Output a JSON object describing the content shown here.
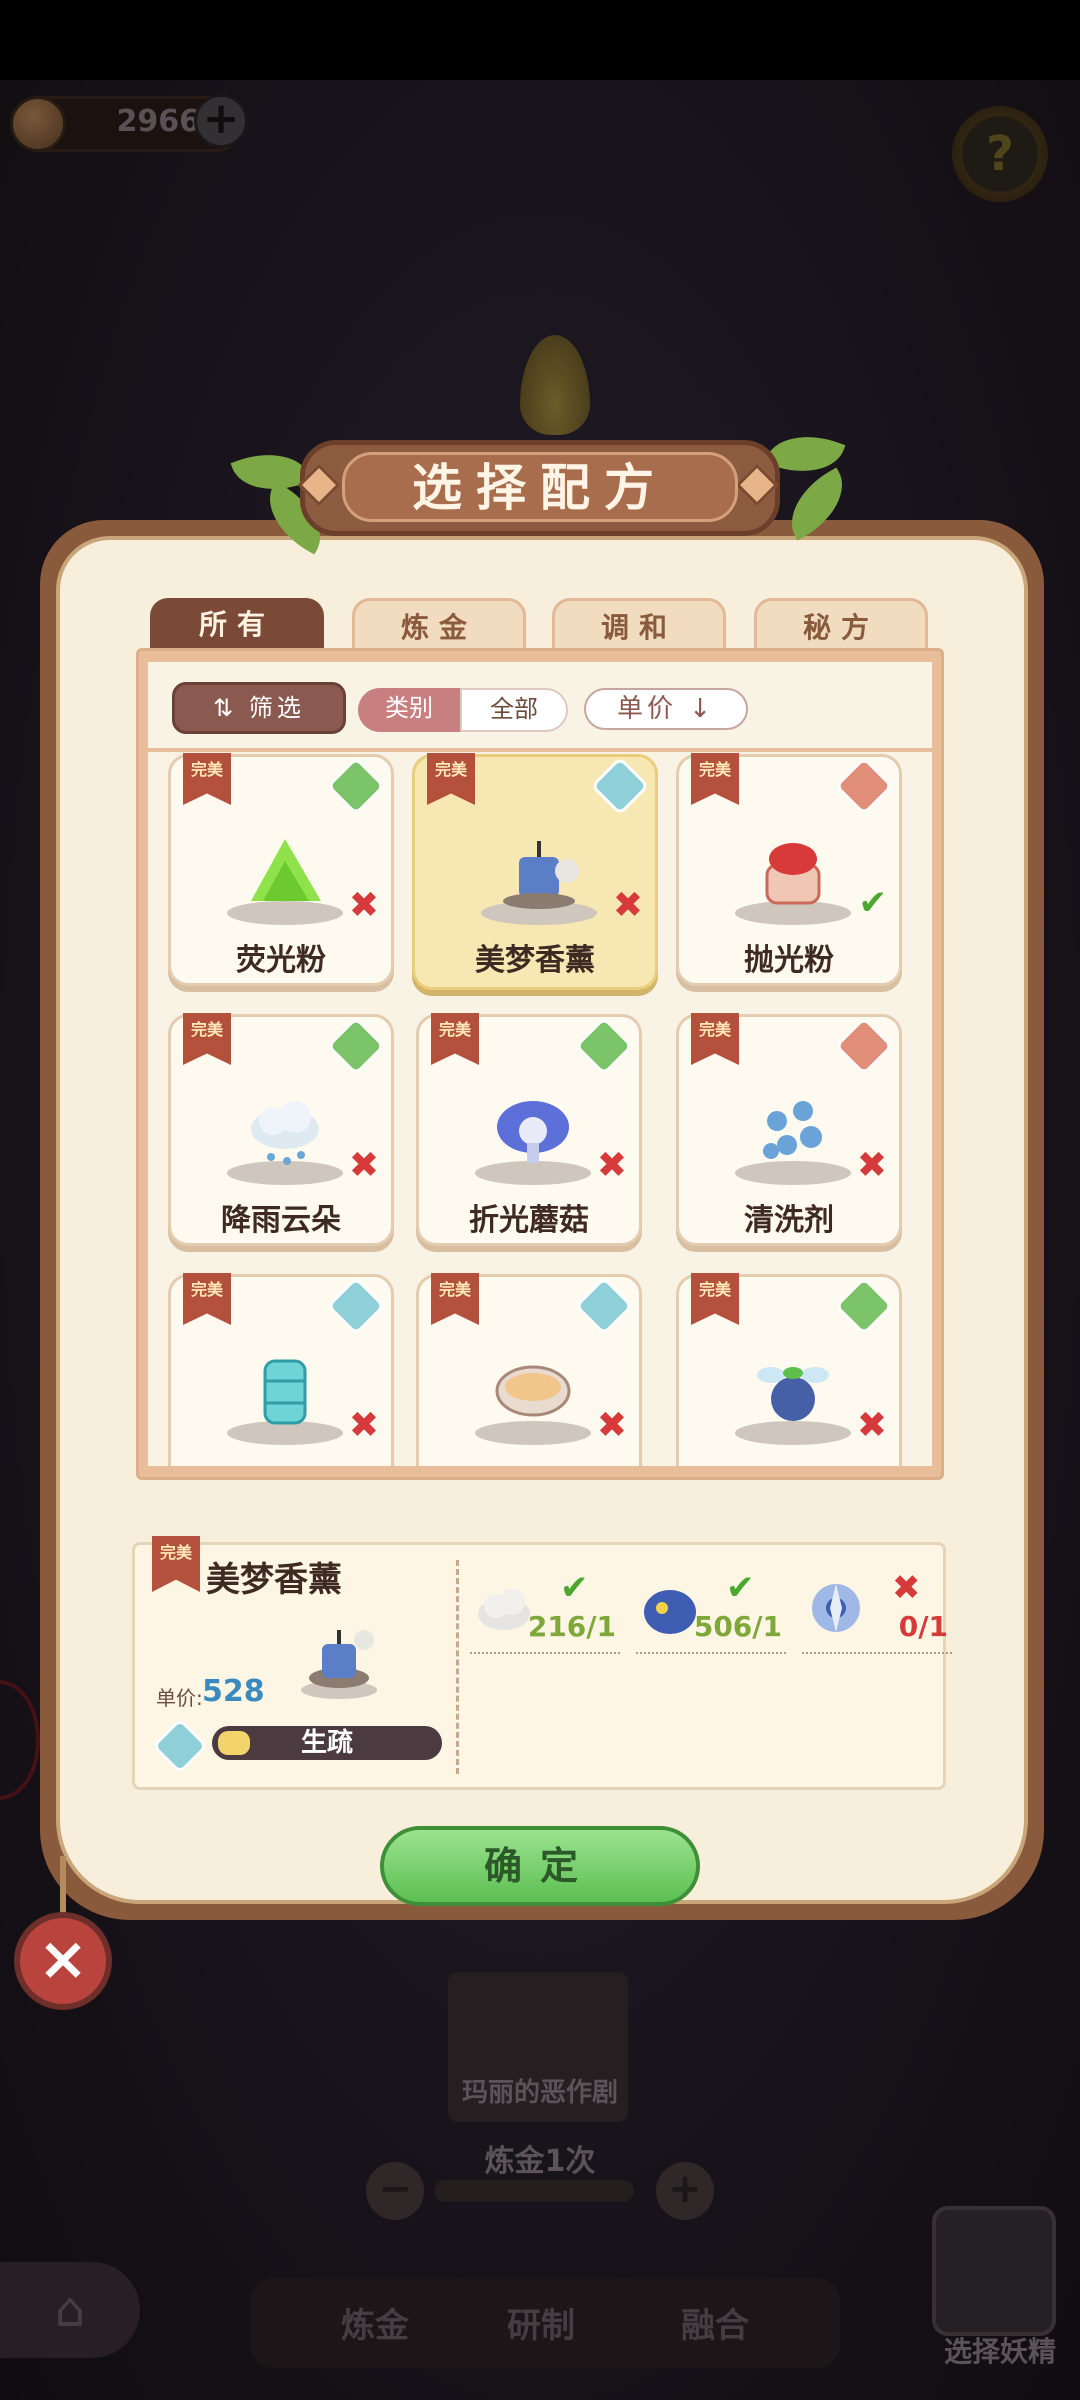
{
  "topbar": {
    "currency_value": "2966",
    "plus_label": "+",
    "help_label": "?"
  },
  "modal": {
    "title": "选择配方",
    "tabs": [
      {
        "label": "所有",
        "active": true
      },
      {
        "label": "炼金",
        "active": false
      },
      {
        "label": "调和",
        "active": false
      },
      {
        "label": "秘方",
        "active": false
      }
    ],
    "filter_label": "筛选",
    "category_label": "类别",
    "category_value": "全部",
    "sort_label": "单价"
  },
  "recipes": [
    {
      "name": "荧光粉",
      "badge": "完美",
      "tag_color": "#7cc46a",
      "status": "x",
      "icon": "green-powder-icon"
    },
    {
      "name": "美梦香薰",
      "badge": "完美",
      "tag_color": "#8fd0d8",
      "status": "x",
      "icon": "candle-icon",
      "selected": true
    },
    {
      "name": "抛光粉",
      "badge": "完美",
      "tag_color": "#e28f7a",
      "status": "check",
      "icon": "red-jar-icon"
    },
    {
      "name": "降雨云朵",
      "badge": "完美",
      "tag_color": "#7cc46a",
      "status": "x",
      "icon": "rain-cloud-icon"
    },
    {
      "name": "折光蘑菇",
      "badge": "完美",
      "tag_color": "#7cc46a",
      "status": "x",
      "icon": "blue-mushroom-icon"
    },
    {
      "name": "清洗剂",
      "badge": "完美",
      "tag_color": "#e28f7a",
      "status": "x",
      "icon": "blue-flowers-icon"
    },
    {
      "name": "",
      "badge": "完美",
      "tag_color": "#8fd0d8",
      "status": "x",
      "icon": "glass-vase-icon"
    },
    {
      "name": "",
      "badge": "完美",
      "tag_color": "#8fd0d8",
      "status": "x",
      "icon": "soup-bowl-icon"
    },
    {
      "name": "",
      "badge": "完美",
      "tag_color": "#7cc46a",
      "status": "x",
      "icon": "winged-berry-icon"
    }
  ],
  "detail": {
    "badge": "完美",
    "name": "美梦香薰",
    "price_label": "单价:",
    "price": "528",
    "proficiency": "生疏",
    "proficiency_fraction": 0.12,
    "ingredients": [
      {
        "icon": "cloud-icon",
        "count": "216/1",
        "ok": true
      },
      {
        "icon": "blue-slime-icon",
        "count": "506/1",
        "ok": true
      },
      {
        "icon": "pinwheel-flower-icon",
        "count": "0/1",
        "ok": false
      }
    ]
  },
  "confirm_label": "确定",
  "close_label": "×",
  "background": {
    "card_title": "玛丽的恶作剧",
    "count_label": "炼金1次",
    "minus_label": "−",
    "plus_label": "+",
    "bottom_tabs": [
      "炼金",
      "研制",
      "融合"
    ],
    "fairy_label": "选择妖精"
  }
}
